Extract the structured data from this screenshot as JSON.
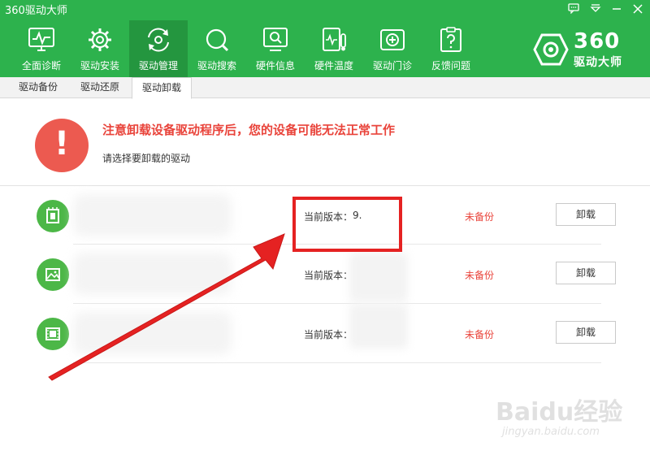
{
  "window": {
    "title": "360驱动大师",
    "controls": [
      "feedback-icon",
      "dropdown-icon",
      "minimize-icon",
      "close-icon"
    ]
  },
  "nav": {
    "items": [
      {
        "label": "全面诊断",
        "icon": "monitor-pulse-icon"
      },
      {
        "label": "驱动安装",
        "icon": "gear-icon"
      },
      {
        "label": "驱动管理",
        "icon": "refresh-gear-icon",
        "active": true
      },
      {
        "label": "驱动搜索",
        "icon": "search-icon"
      },
      {
        "label": "硬件信息",
        "icon": "screen-search-icon"
      },
      {
        "label": "硬件温度",
        "icon": "temperature-icon"
      },
      {
        "label": "驱动门诊",
        "icon": "clinic-icon"
      },
      {
        "label": "反馈问题",
        "icon": "question-clipboard-icon"
      }
    ]
  },
  "logo": {
    "number": "360",
    "text": "驱动大师"
  },
  "subtabs": [
    {
      "label": "驱动备份"
    },
    {
      "label": "驱动还原"
    },
    {
      "label": "驱动卸载",
      "active": true
    }
  ],
  "warning": {
    "symbol": "!",
    "title": "注意卸载设备驱动程序后，您的设备可能无法正常工作",
    "subtitle": "请选择要卸载的驱动"
  },
  "drivers": [
    {
      "icon": "chip-icon",
      "version_label": "当前版本：",
      "version_value": "9.",
      "backup_status": "未备份",
      "action_label": "卸载"
    },
    {
      "icon": "image-icon",
      "version_label": "当前版本：",
      "version_value": "",
      "backup_status": "未备份",
      "action_label": "卸载"
    },
    {
      "icon": "film-icon",
      "version_label": "当前版本：",
      "version_value": "",
      "backup_status": "未备份",
      "action_label": "卸载"
    }
  ],
  "watermark": {
    "main": "Baidu经验",
    "sub": "jingyan.baidu.com"
  },
  "colors": {
    "header_green": "#2db24d",
    "active_tab": "#24963f",
    "warning_red": "#ec5a50",
    "alert_text": "#e9443b",
    "highlight_red": "#e52222"
  }
}
